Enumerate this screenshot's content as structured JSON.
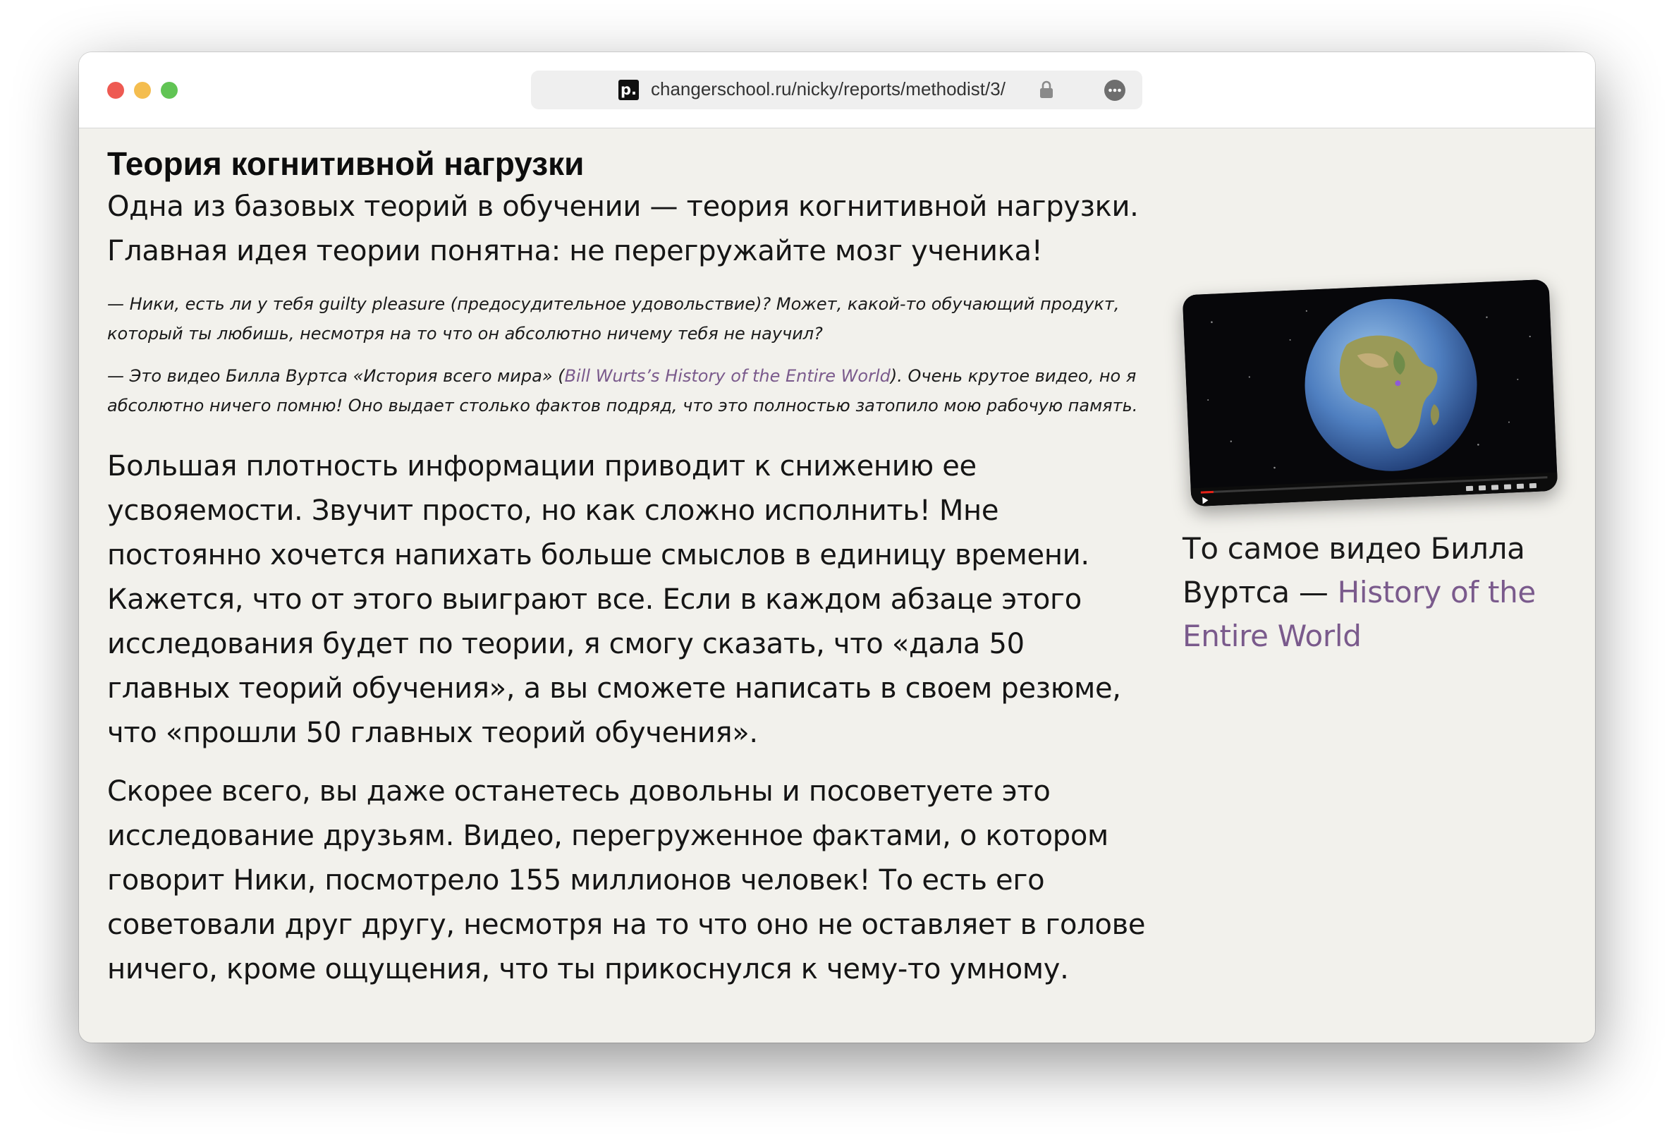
{
  "browser": {
    "url": "changerschool.ru/nicky/reports/methodist/3/",
    "site_icon_label": "p."
  },
  "article": {
    "heading": "Теория когнитивной нагрузки",
    "lead": "Одна из базовых теорий в обучении — теория когнитивной нагрузки. Главная идея теории понятна: не перегружайте мозг ученика!",
    "quote1": "— Ники, есть ли у тебя guilty pleasure (предосудительное удовольствие)? Может, какой-то обучающий продукт, который ты любишь, несмотря на то что он абсолютно ничему тебя не научил?",
    "quote2_before": "— Это видео Билла Вуртса «История всего мира» (",
    "quote2_link": "Bill Wurts’s History of the Entire World",
    "quote2_after": "). Очень крутое видео, но я абсолютно ничего помню! Оно выдает столько фактов подряд, что это полностью затопило мою рабочую память.",
    "para1": "Большая плотность информации приводит к снижению ее усвояемости. Звучит просто, но как сложно исполнить! Мне постоянно хочется напихать больше смыслов в единицу времени. Кажется, что от этого выиграют все. Если в каждом абзаце этого исследования будет по теории, я смогу сказать, что «дала 50 главных теорий обучения», а вы сможете написать в своем резюме, что «прошли 50 главных теорий обучения».",
    "para2": "Скорее всего, вы даже останетесь довольны и посоветуете это исследование друзьям. Видео, перегруженное фактами, о котором говорит Ники, посмотрело 155 миллионов человек! То есть его советовали друг другу, несмотря на то что оно не оставляет в голове ничего, кроме ощущения, что ты прикоснулся к чему-то умному."
  },
  "sidebar": {
    "caption_text": "То самое видео Билла Вуртса — ",
    "caption_link": "History of the Entire World"
  },
  "colors": {
    "page_bg": "#f2f1ec",
    "link": "#7a5a8c",
    "text": "#151515"
  },
  "icons": [
    "site-favicon-icon",
    "lock-icon",
    "more-options-icon",
    "play-icon",
    "earth-image"
  ]
}
